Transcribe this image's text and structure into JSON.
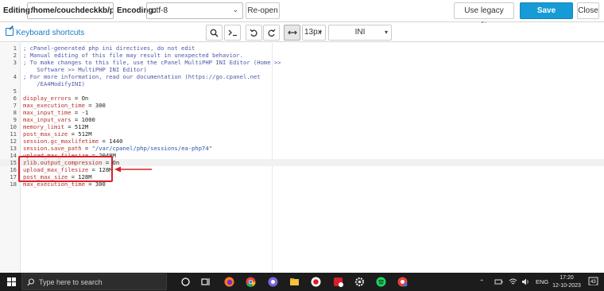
{
  "topbar": {
    "editing_label": "Editing:",
    "file_path": "/home/couchdeckkb/pu!",
    "encoding_label": "Encoding:",
    "encoding_value": "utf-8",
    "reopen_label": "Re-open",
    "legacy_label": "Use legacy editor",
    "save_label": "Save Changes",
    "close_label": "Close"
  },
  "toolbar": {
    "shortcuts_label": "Keyboard shortcuts",
    "font_size": "13px",
    "mode": "INI"
  },
  "editor": {
    "lines": [
      {
        "n": "1",
        "text": "; cPanel-generated php ini directives, do not edit"
      },
      {
        "n": "2",
        "text": "; Manual editing of this file may result in unexpected behavior."
      },
      {
        "n": "3",
        "text": "; To make changes to this file, use the cPanel MultiPHP INI Editor (Home >>"
      },
      {
        "n": "",
        "text": "    Software >> MultiPHP INI Editor)"
      },
      {
        "n": "4",
        "text": "; For more information, read our documentation (https://go.cpanel.net"
      },
      {
        "n": "",
        "text": "    /EA4ModifyINI)"
      },
      {
        "n": "5",
        "text": ""
      },
      {
        "n": "6",
        "text": "display_errors = On"
      },
      {
        "n": "7",
        "text": "max_execution_time = 300"
      },
      {
        "n": "8",
        "text": "max_input_time = -1"
      },
      {
        "n": "9",
        "text": "max_input_vars = 1000"
      },
      {
        "n": "10",
        "text": "memory_limit = 512M"
      },
      {
        "n": "11",
        "text": "post_max_size = 512M"
      },
      {
        "n": "12",
        "text": "session.gc_maxlifetime = 1440"
      },
      {
        "n": "13",
        "text": "session.save_path = \"/var/cpanel/php/sessions/ea-php74\""
      },
      {
        "n": "14",
        "text": "upload_max_filesize = 2048M"
      },
      {
        "n": "15",
        "text": "zlib.output_compression = On"
      },
      {
        "n": "16",
        "text": "upload_max_filesize = 128M"
      },
      {
        "n": "17",
        "text": "post_max_size = 128M"
      },
      {
        "n": "18",
        "text": "max_execution_time = 300"
      }
    ]
  },
  "taskbar": {
    "search_placeholder": "Type here to search",
    "language": "ENG",
    "time": "17:20",
    "date": "12-10-2023",
    "notification_count": "43"
  },
  "colors": {
    "primary": "#179bd7",
    "highlight_box": "#d8202a",
    "link": "#1a7bc4"
  }
}
